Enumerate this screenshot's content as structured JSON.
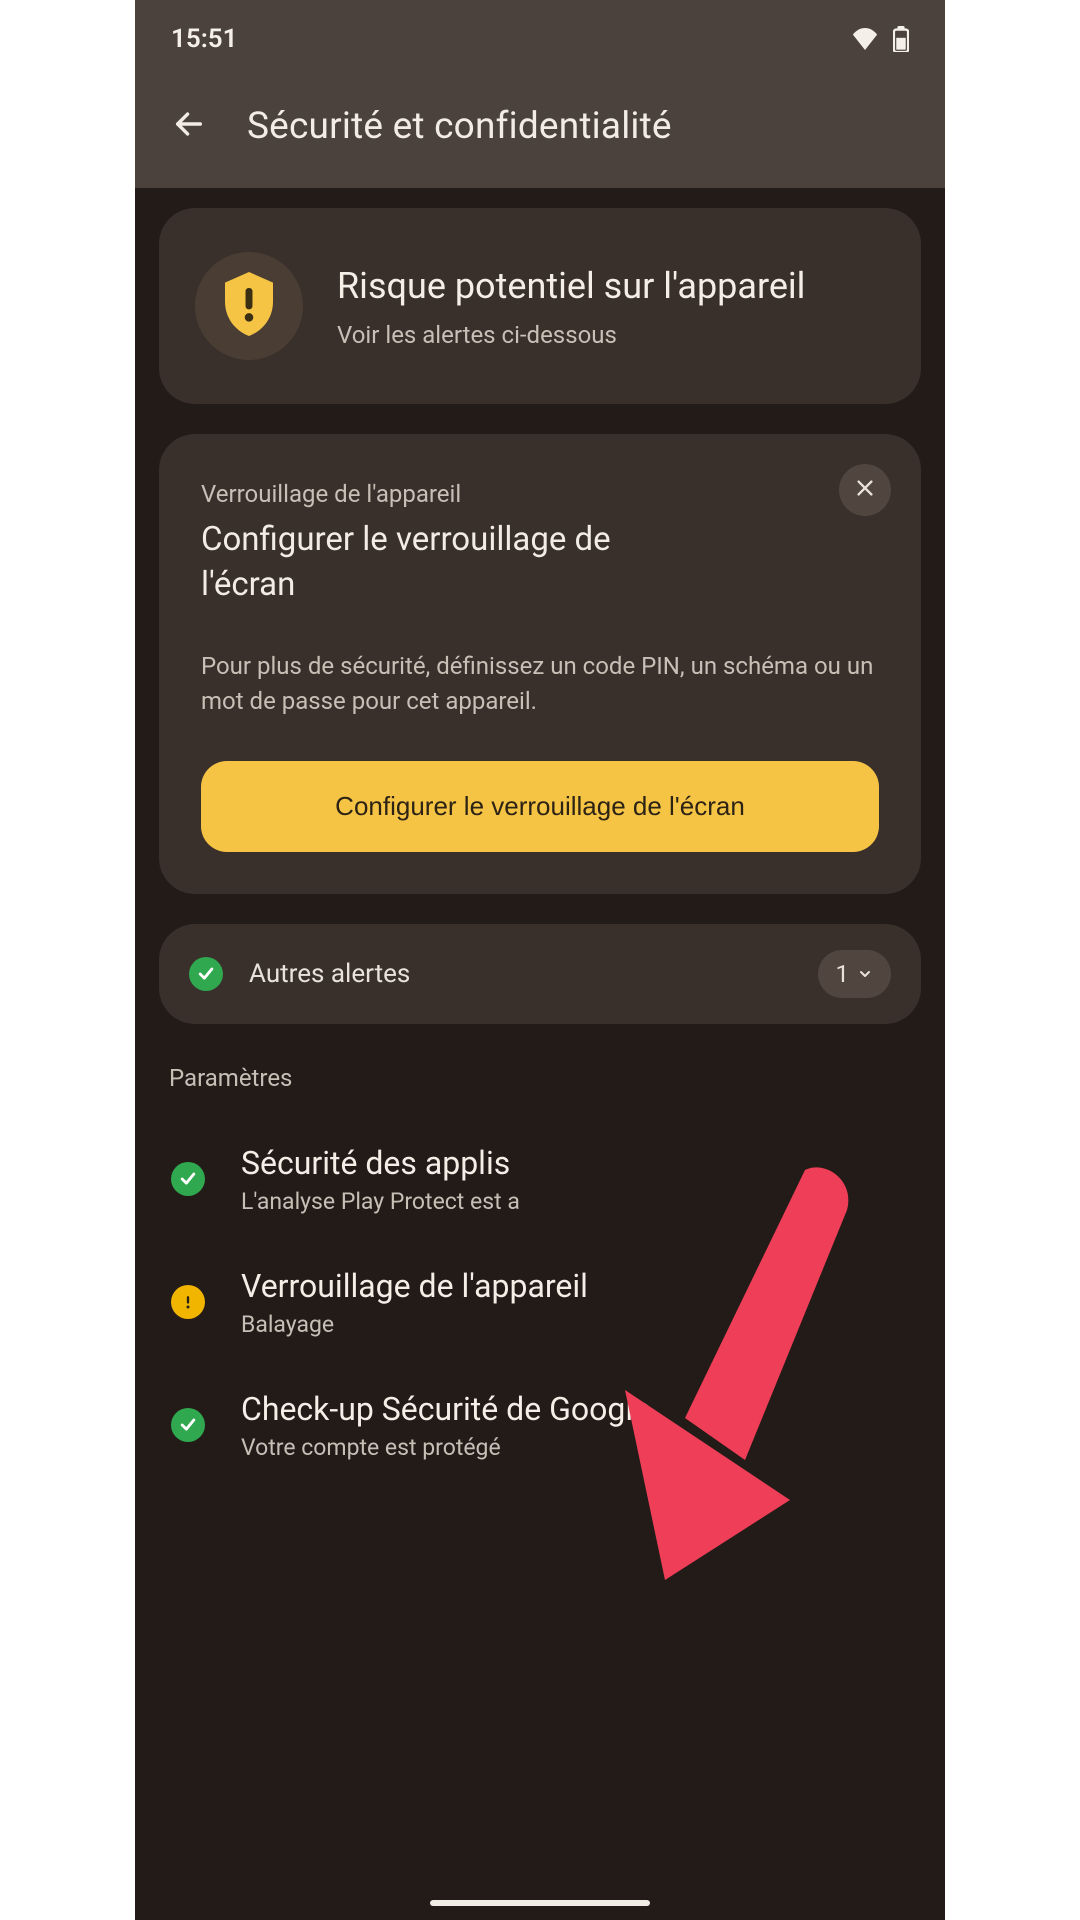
{
  "status": {
    "time": "15:51"
  },
  "header": {
    "title": "Sécurité et confidentialité"
  },
  "alert": {
    "title": "Risque potentiel sur l'appareil",
    "subtitle": "Voir les alertes ci-dessous"
  },
  "lock_card": {
    "eyebrow": "Verrouillage de l'appareil",
    "title": "Configurer le verrouillage de l'écran",
    "description": "Pour plus de sécurité, définissez un code PIN, un schéma ou un mot de passe pour cet appareil.",
    "button": "Configurer le verrouillage de l'écran"
  },
  "other_alerts": {
    "label": "Autres alertes",
    "count": "1"
  },
  "section": {
    "title": "Paramètres"
  },
  "settings": {
    "app_security": {
      "title": "Sécurité des applis",
      "subtitle": "L'analyse Play Protect est a"
    },
    "device_lock": {
      "title": "Verrouillage de l'appareil",
      "subtitle": "Balayage"
    },
    "google_check": {
      "title": "Check-up Sécurité de Google",
      "subtitle": "Votre compte est protégé"
    }
  },
  "colors": {
    "accent": "#f6c445",
    "cardBg": "#39302b",
    "bg": "#231b18"
  }
}
